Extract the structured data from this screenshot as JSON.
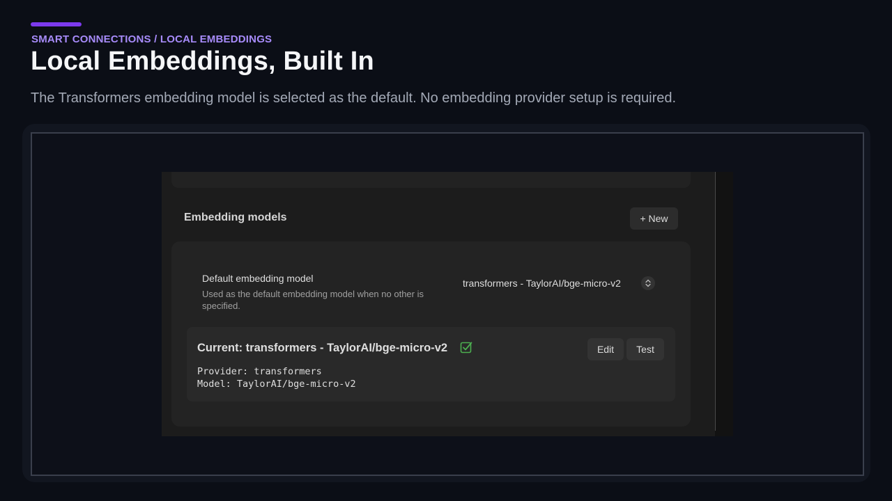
{
  "header": {
    "eyebrow": "SMART CONNECTIONS / LOCAL EMBEDDINGS",
    "title": "Local Embeddings, Built In",
    "subtitle": "The Transformers embedding model is selected as the default. No embedding provider setup is required."
  },
  "colors": {
    "accent": "#7c3aed",
    "eyebrow": "#a78bfa",
    "background": "#0b0e16",
    "check": "#4caf50"
  },
  "settings": {
    "section_heading": "Embedding models",
    "new_button": "+ New",
    "default_model": {
      "name": "Default embedding model",
      "description": "Used as the default embedding model when no other is specified.",
      "selected_value": "transformers - TaylorAI/bge-micro-v2",
      "select_icon": "chevrons-up-down-icon"
    },
    "current": {
      "title": "Current: transformers - TaylorAI/bge-micro-v2",
      "status_icon": "check-square-icon",
      "edit_button": "Edit",
      "test_button": "Test",
      "provider_line": "Provider: transformers",
      "model_line": "Model: TaylorAI/bge-micro-v2"
    }
  }
}
